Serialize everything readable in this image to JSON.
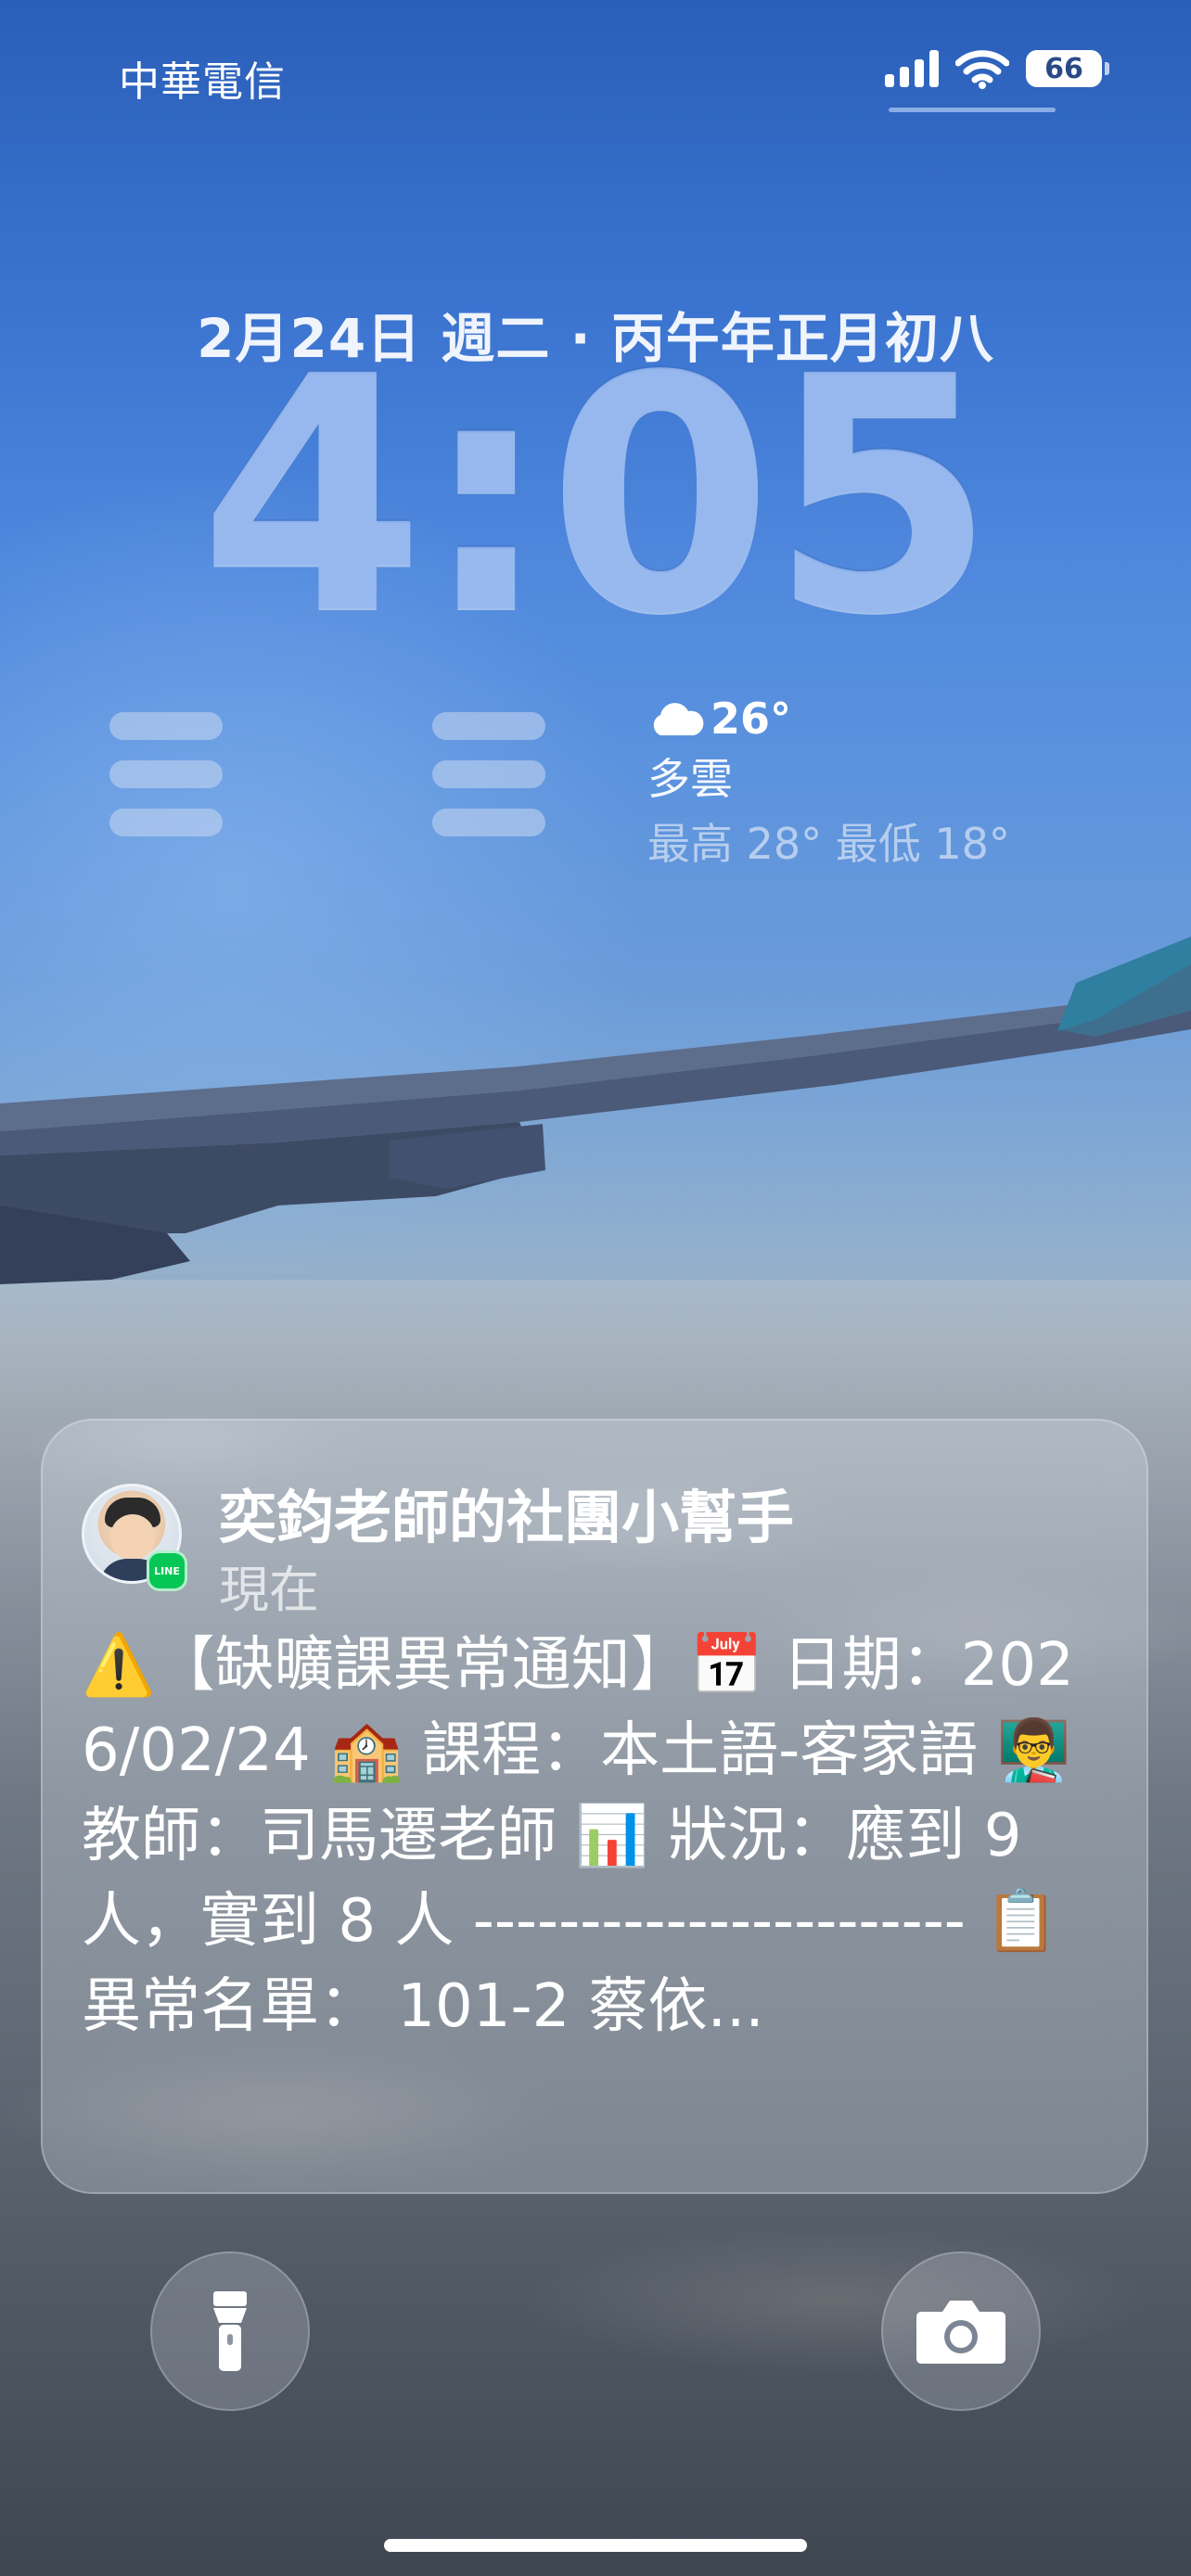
{
  "status_bar": {
    "carrier": "中華電信",
    "battery": "66",
    "icons": [
      "signal-icon",
      "wifi-icon",
      "battery-icon"
    ]
  },
  "lock_screen": {
    "date": "2月24日 週二 · 丙午年正月初八",
    "time": "4:05"
  },
  "weather": {
    "icon": "cloud-icon",
    "temperature": "26°",
    "condition": "多雲",
    "range": "最高 28° 最低 18°"
  },
  "notification": {
    "app_icon": "line-icon",
    "title": "奕鈞老師的社團小幫手",
    "time": "現在",
    "body": "⚠️【缺曠課異常通知】📅 日期：2026/02/24 🏫 課程：本土語-客家語 👨‍🏫 教師：司馬遷老師 📊 狀況：應到 9 人，實到 8 人 ----------------------- 📋 異常名單： 101-2 蔡依..."
  },
  "bottom_controls": {
    "flashlight": "flashlight-icon",
    "camera": "camera-icon"
  },
  "colors": {
    "line_green": "#06c755",
    "clock_tint": "#96b9f0"
  }
}
